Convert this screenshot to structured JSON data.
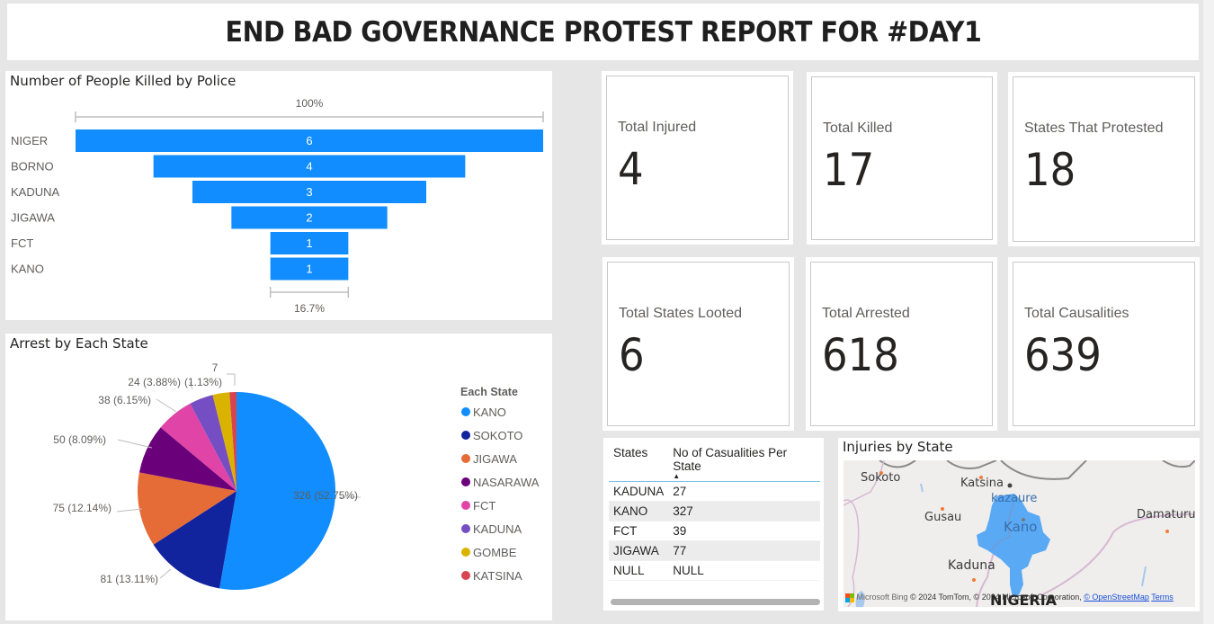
{
  "header": {
    "title": "END BAD GOVERNANCE PROTEST REPORT FOR #DAY1"
  },
  "funnel": {
    "title": "Number of People Killed by Police",
    "top_pct_label": "100%",
    "bottom_pct_label": "16.7%",
    "bar_color": "#118dff"
  },
  "pie": {
    "title": "Arrest by Each State",
    "legend_title": "Each State"
  },
  "cards": [
    {
      "label": "Total Injured",
      "value": "4"
    },
    {
      "label": "Total Killed",
      "value": "17"
    },
    {
      "label": "States That Protested",
      "value": "18"
    },
    {
      "label": "Total States Looted",
      "value": "6"
    },
    {
      "label": "Total Arrested",
      "value": "618"
    },
    {
      "label": "Total Causalities",
      "value": "639"
    }
  ],
  "table": {
    "columns": [
      "States",
      "No of Casualities Per State"
    ],
    "sort_indicator": "▲",
    "rows": [
      [
        "KADUNA",
        "27"
      ],
      [
        "KANO",
        "327"
      ],
      [
        "FCT",
        "39"
      ],
      [
        "JIGAWA",
        "77"
      ],
      [
        "NULL",
        "NULL"
      ]
    ]
  },
  "map": {
    "title": "Injuries by State",
    "labels": [
      "Sokoto",
      "Katsina",
      "kazaure",
      "Gusau",
      "Kano",
      "Damaturu",
      "Kaduna",
      "NIGERIA"
    ],
    "highlight_color": "#5aa9f5",
    "attribution": {
      "brand": "Microsoft Bing",
      "text": "© 2024 TomTom, © 2024 Microsoft Corporation,",
      "osm_link": "© OpenStreetMap",
      "terms_link": "Terms"
    }
  },
  "chart_data": [
    {
      "type": "bar",
      "subtype": "funnel",
      "title": "Number of People Killed by Police",
      "categories": [
        "NIGER",
        "BORNO",
        "KADUNA",
        "JIGAWA",
        "FCT",
        "KANO"
      ],
      "values": [
        6,
        4,
        3,
        2,
        1,
        1
      ],
      "annotations": {
        "top": "100%",
        "bottom": "16.7%"
      }
    },
    {
      "type": "pie",
      "title": "Arrest by Each State",
      "legend_title": "Each State",
      "legend_position": "right",
      "categories": [
        "KANO",
        "SOKOTO",
        "JIGAWA",
        "NASARAWA",
        "FCT",
        "KADUNA",
        "GOMBE",
        "KATSINA"
      ],
      "values": [
        326,
        81,
        75,
        50,
        38,
        24,
        17,
        7
      ],
      "colors": [
        "#118dff",
        "#12239e",
        "#e66c37",
        "#6b007b",
        "#e044a7",
        "#744ec2",
        "#d9b300",
        "#d64550"
      ],
      "data_labels": [
        "326 (52.75%)",
        "81 (13.11%)",
        "75 (12.14%)",
        "50 (8.09%)",
        "38 (6.15%)",
        "24 (3.88%)",
        "",
        "7"
      ],
      "extra_label": "(1.13%)"
    }
  ]
}
